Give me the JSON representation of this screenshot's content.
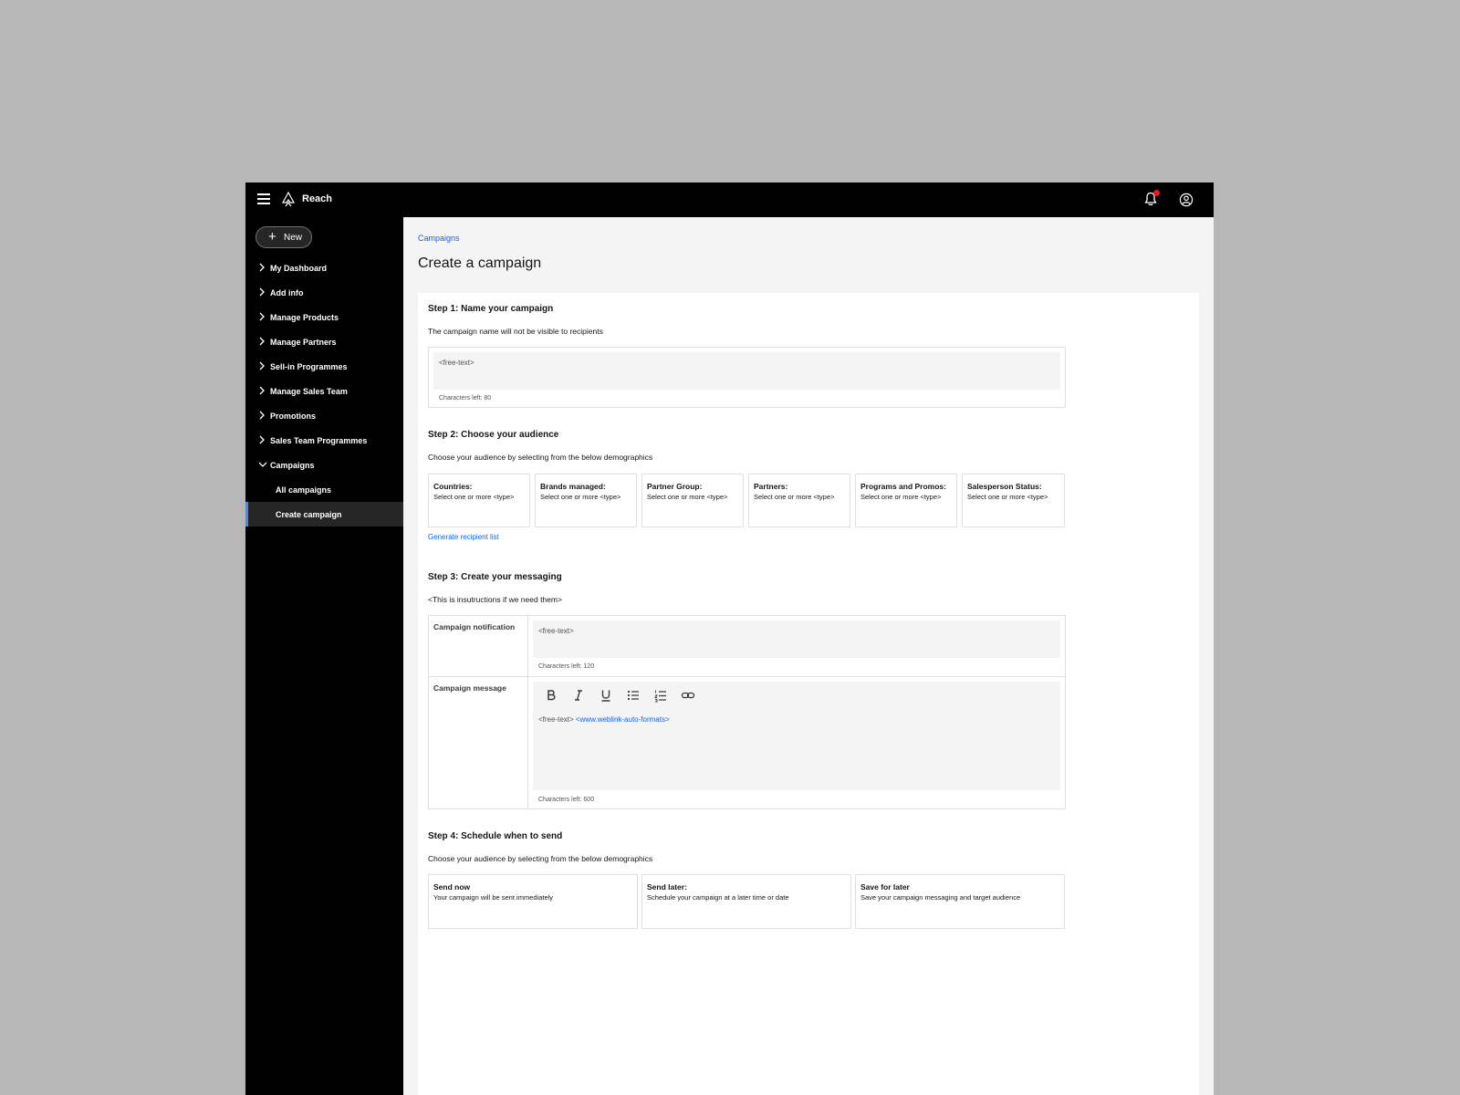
{
  "app": {
    "title": "Reach"
  },
  "sidebar": {
    "new_label": "New",
    "items": [
      {
        "label": "My Dashboard"
      },
      {
        "label": "Add info"
      },
      {
        "label": "Manage Products"
      },
      {
        "label": "Manage Partners"
      },
      {
        "label": "Sell-in Programmes"
      },
      {
        "label": "Manage Sales Team"
      },
      {
        "label": "Promotions"
      },
      {
        "label": "Sales Team Programmes"
      },
      {
        "label": "Campaigns"
      }
    ],
    "subitems": [
      {
        "label": "All campaigns"
      },
      {
        "label": "Create campaign"
      }
    ]
  },
  "main": {
    "breadcrumb": "Campaigns",
    "title": "Create a campaign",
    "step1": {
      "heading": "Step 1: Name your campaign",
      "description": "The campaign name will not be visible to recipients",
      "placeholder": "<free-text>",
      "chars_left": "Characters left: 80"
    },
    "step2": {
      "heading": "Step 2: Choose your audience",
      "description": "Choose your audience by selecting from the below demographics",
      "filters": [
        {
          "title": "Countries:",
          "sub": "Select one or more <type>"
        },
        {
          "title": "Brands managed:",
          "sub": "Select one or more <type>"
        },
        {
          "title": "Partner Group:",
          "sub": "Select one or more <type>"
        },
        {
          "title": "Partners:",
          "sub": "Select one or more <type>"
        },
        {
          "title": "Programs and Promos:",
          "sub": "Select one or more <type>"
        },
        {
          "title": "Salesperson Status:",
          "sub": "Select one or more <type>"
        }
      ],
      "generate_link": "Generate recipient list"
    },
    "step3": {
      "heading": "Step 3: Create your messaging",
      "description": "<This is insutructions  if we need them>",
      "notification_label": "Campaign notification",
      "notification_placeholder": "<free-text>",
      "notification_chars_left": "Characters left: 120",
      "message_label": "Campaign message",
      "message_text": "<free-text>",
      "message_link": "<www.weblink-auto-formats>",
      "message_chars_left": "Characters left: 600"
    },
    "step4": {
      "heading": "Step 4: Schedule when to send",
      "description": "Choose your audience by selecting from the below demographics",
      "options": [
        {
          "title": "Send now",
          "sub": "Your campaign will be sent immediately"
        },
        {
          "title": "Send later:",
          "sub": "Schedule your campaign at a later time or date"
        },
        {
          "title": "Save for later",
          "sub": "Save your campaign messaging and target audience"
        }
      ]
    }
  },
  "colors": {
    "accent": "#0f62fe",
    "active_bar": "#4589ff",
    "notification": "#da1e28"
  }
}
